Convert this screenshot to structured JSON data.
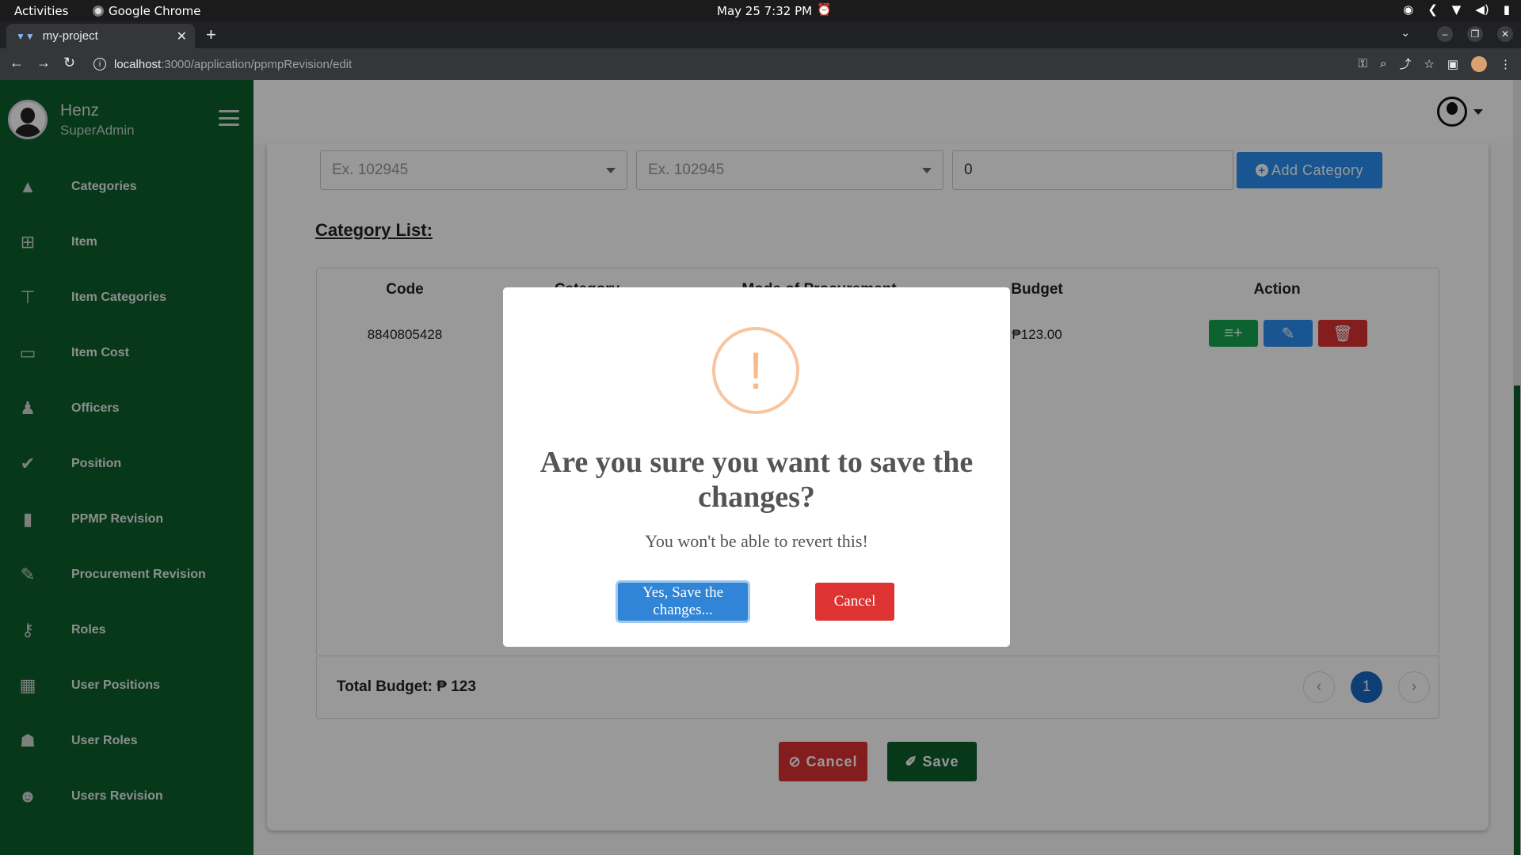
{
  "os": {
    "activities": "Activities",
    "app_name": "Google Chrome",
    "clock": "May 25  7:32 PM"
  },
  "browser": {
    "tab_title": "my-project",
    "url_host": "localhost",
    "url_path": ":3000/application/ppmpRevision/edit"
  },
  "sidebar": {
    "user_name": "Henz",
    "user_role": "SuperAdmin",
    "items": [
      {
        "label": "Categories",
        "icon": "shapes-icon"
      },
      {
        "label": "Item",
        "icon": "plus-square-icon"
      },
      {
        "label": "Item Categories",
        "icon": "sitemap-icon"
      },
      {
        "label": "Item Cost",
        "icon": "money-bill-icon"
      },
      {
        "label": "Officers",
        "icon": "office-chair-icon"
      },
      {
        "label": "Position",
        "icon": "user-check-icon"
      },
      {
        "label": "PPMP Revision",
        "icon": "book-icon"
      },
      {
        "label": "Procurement Revision",
        "icon": "edit-doc-icon"
      },
      {
        "label": "Roles",
        "icon": "user-key-icon"
      },
      {
        "label": "User Positions",
        "icon": "building-gear-icon"
      },
      {
        "label": "User Roles",
        "icon": "user-lock-icon"
      },
      {
        "label": "Users Revision",
        "icon": "users-icon"
      }
    ]
  },
  "form": {
    "select1_placeholder": "Ex. 102945",
    "select2_placeholder": "Ex. 102945",
    "budget_value": "0",
    "add_button": "Add Category"
  },
  "table": {
    "title": "Category List:",
    "headers": [
      "Code",
      "Category",
      "Mode of Procurement",
      "Budget",
      "Action"
    ],
    "rows": [
      {
        "code": "8840805428",
        "budget": "₱123.00"
      }
    ]
  },
  "footer": {
    "total_label": "Total Budget: ₱ 123",
    "current_page": "1"
  },
  "actions": {
    "cancel": "Cancel",
    "save": "Save"
  },
  "modal": {
    "icon": "!",
    "title": "Are you sure you want to save the changes?",
    "text": "You won't be able to revert this!",
    "confirm": "Yes, Save the changes...",
    "cancel": "Cancel"
  },
  "colors": {
    "sidebar": "#0d5e2c",
    "primary": "#2a8ef0",
    "danger": "#dd3333",
    "success": "#17a550",
    "warning_icon": "#f8bb86"
  }
}
